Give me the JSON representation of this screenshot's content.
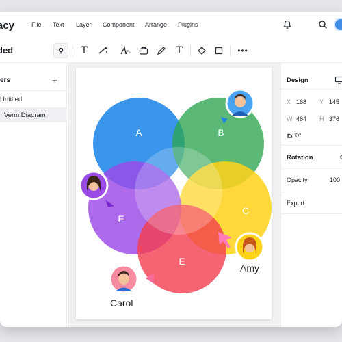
{
  "app": {
    "name": "acy"
  },
  "menu": [
    "File",
    "Text",
    "Layer",
    "Component",
    "Arrange",
    "Plugins"
  ],
  "toolbar": {
    "doc_name": "ded"
  },
  "layers_panel": {
    "title": "ers",
    "add": "+",
    "pages": [
      {
        "label": "Untitled",
        "active": false
      },
      {
        "label": "Verm Diagram",
        "active": true
      }
    ]
  },
  "canvas": {
    "circles": [
      {
        "label": "A",
        "color": "#1f86e8"
      },
      {
        "label": "B",
        "color": "#2ea44f"
      },
      {
        "label": "C",
        "color": "#ffd21a"
      },
      {
        "label": "E",
        "color": "#9b4be6"
      },
      {
        "label": "E",
        "color": "#f23d4f"
      }
    ],
    "collaborators": [
      {
        "name": "Amy"
      },
      {
        "name": "Carol"
      }
    ]
  },
  "design_panel": {
    "tab": "Design",
    "x_label": "X",
    "x_value": "168",
    "y_label": "Y",
    "y_value": "145",
    "w_label": "W",
    "w_value": "464",
    "h_label": "H",
    "h_value": "376",
    "rotation_value": "0°",
    "rotation_title": "Rotation",
    "rotation_trunc": "C",
    "opacity_label": "Opacity",
    "opacity_value": "100",
    "export_label": "Export"
  },
  "colors": {
    "accent": "#3f8de8"
  }
}
